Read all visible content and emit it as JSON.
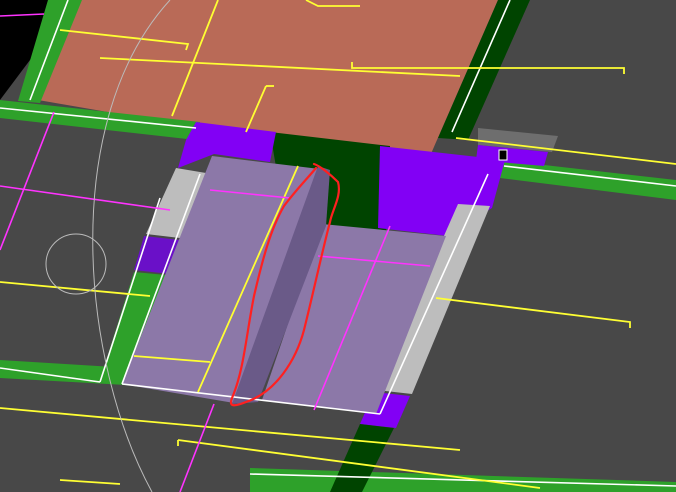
{
  "viewport": {
    "background_color": "#484848",
    "void_color": "#000000"
  },
  "colors": {
    "floor_dark_gray": "#484848",
    "terracotta_surface": "#b96a57",
    "wall_green_bright": "#2ea12a",
    "wall_green_dark": "#004400",
    "purple_bright": "#8200f5",
    "purple_medium": "#6a10c8",
    "lavender_surface": "#8c78a8",
    "lavender_shadow": "#6a5a88",
    "light_gray_trim": "#bdbdbd",
    "edge_white": "#ffffff",
    "grid_yellow": "#ffff33",
    "grid_magenta": "#ff33ff",
    "annotation_red": "#ff2020",
    "guide_gray": "#bbbbbb"
  },
  "annotation": {
    "type": "freehand-outline",
    "color": "#ff2020"
  }
}
